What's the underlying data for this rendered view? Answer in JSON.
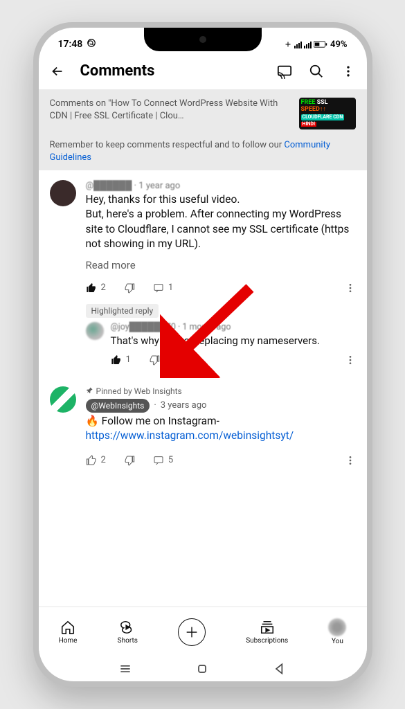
{
  "status": {
    "time": "17:48",
    "battery": "49%"
  },
  "header": {
    "title": "Comments"
  },
  "banner": {
    "context_prefix": "Comments on \"How To Connect WordPress Website With CDN | Free SSL Certificate | Clou…",
    "guideline_text": "Remember to keep comments respectful and to follow our ",
    "guideline_link": "Community Guidelines",
    "thumb": {
      "l1a": "FREE",
      "l1b": "SSL",
      "l2": "SPEED↑↑",
      "l3": "CLOUDFLARE CDN",
      "l4": "HINDI"
    }
  },
  "comments": [
    {
      "author": "@██████",
      "age": "1 year ago",
      "text": "Hey, thanks for this useful video.\nBut, here's a problem. After connecting my WordPress site to Cloudflare, I cannot see my SSL certificate (https not showing in my URL).",
      "readmore": "Read more",
      "likes": "2",
      "replies": "1",
      "reply": {
        "badge": "Highlighted reply",
        "author": "@joy██████70",
        "age": "1 month ago",
        "text": "That's why I'm not replacing my nameservers.",
        "likes": "1"
      }
    },
    {
      "pinned": "Pinned by Web Insights",
      "author_chip": "@WebInsights",
      "age": "3 years ago",
      "emoji": "🔥",
      "text_prefix": " Follow me on Instagram- ",
      "link": "https://www.instagram.com/webinsightsyt/",
      "likes": "2",
      "replies": "5"
    }
  ],
  "nav": {
    "home": "Home",
    "shorts": "Shorts",
    "subs": "Subscriptions",
    "you": "You"
  }
}
